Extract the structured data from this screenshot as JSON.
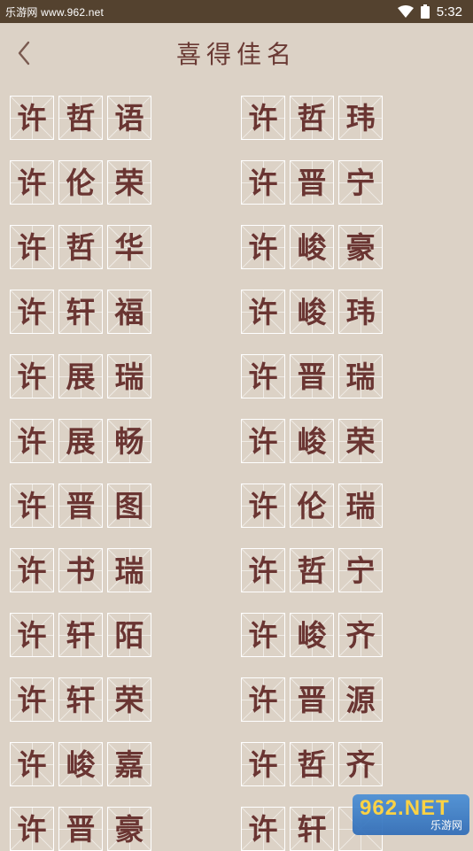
{
  "status_bar": {
    "watermark": "乐游网 www.962.net",
    "time": "5:32",
    "icons": [
      "wifi-icon",
      "battery-icon"
    ]
  },
  "header": {
    "back_icon": "chevron-left-icon",
    "title": "喜得佳名"
  },
  "names": {
    "left": [
      [
        "许",
        "哲",
        "语"
      ],
      [
        "许",
        "伦",
        "荣"
      ],
      [
        "许",
        "哲",
        "华"
      ],
      [
        "许",
        "轩",
        "福"
      ],
      [
        "许",
        "展",
        "瑞"
      ],
      [
        "许",
        "展",
        "畅"
      ],
      [
        "许",
        "晋",
        "图"
      ],
      [
        "许",
        "书",
        "瑞"
      ],
      [
        "许",
        "轩",
        "陌"
      ],
      [
        "许",
        "轩",
        "荣"
      ],
      [
        "许",
        "峻",
        "嘉"
      ],
      [
        "许",
        "晋",
        "豪"
      ]
    ],
    "right": [
      [
        "许",
        "哲",
        "玮"
      ],
      [
        "许",
        "晋",
        "宁"
      ],
      [
        "许",
        "峻",
        "豪"
      ],
      [
        "许",
        "峻",
        "玮"
      ],
      [
        "许",
        "晋",
        "瑞"
      ],
      [
        "许",
        "峻",
        "荣"
      ],
      [
        "许",
        "伦",
        "瑞"
      ],
      [
        "许",
        "哲",
        "宁"
      ],
      [
        "许",
        "峻",
        "齐"
      ],
      [
        "许",
        "晋",
        "源"
      ],
      [
        "许",
        "哲",
        "齐"
      ],
      [
        "许",
        "轩",
        ""
      ]
    ]
  },
  "watermark_logo": {
    "line1": "962.NET",
    "line2": "乐游网"
  },
  "colors": {
    "background": "#dcd2c6",
    "status_bar": "#54422f",
    "accent_text": "#6a3532"
  }
}
